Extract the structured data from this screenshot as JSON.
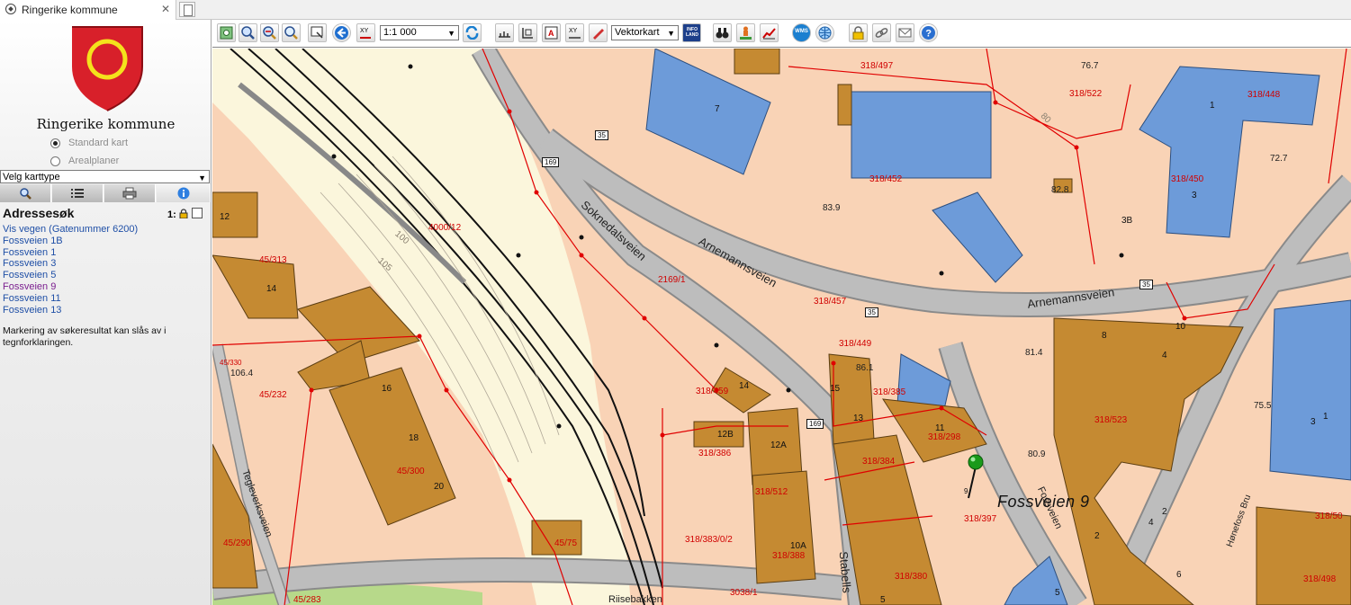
{
  "browser": {
    "tab_title": "Ringerike kommune",
    "close_glyph": "✕",
    "icons": {
      "site": "compass-icon",
      "new_tab": "new-tab-icon"
    }
  },
  "sidebar": {
    "org_name": "Ringerike kommune",
    "map_modes": [
      {
        "label": "Standard kart",
        "selected": true
      },
      {
        "label": "Arealplaner",
        "selected": false
      }
    ],
    "map_type_select": "Velg karttype",
    "tool_tabs": [
      {
        "icon": "search-icon",
        "active": false
      },
      {
        "icon": "layers-list-icon",
        "active": false
      },
      {
        "icon": "print-icon",
        "active": false
      },
      {
        "icon": "info-icon",
        "active": true
      }
    ],
    "panel_title": "Adressesøk",
    "scale_prefix": "1:",
    "lock_icon": "lock-icon",
    "results": [
      {
        "label": "Vis vegen (Gatenummer 6200)",
        "visited": false
      },
      {
        "label": "Fossveien 1B",
        "visited": false
      },
      {
        "label": "Fossveien 1",
        "visited": false
      },
      {
        "label": "Fossveien 3",
        "visited": false
      },
      {
        "label": "Fossveien 5",
        "visited": false
      },
      {
        "label": "Fossveien 9",
        "visited": true
      },
      {
        "label": "Fossveien 11",
        "visited": false
      },
      {
        "label": "Fossveien 13",
        "visited": false
      }
    ],
    "note": "Markering av søkeresultat kan slås av i tegnforklaringen."
  },
  "toolbar": {
    "scale_value": "1:1 000",
    "map_type_value": "Vektorkart",
    "info_land_label": "INFO LAND",
    "wms_label": "WMS",
    "buttons": [
      "zoom-extent-icon",
      "zoom-in-icon",
      "zoom-out-icon",
      "zoom-magnifier-icon",
      "zoom-window-icon",
      "back-arrow-icon",
      "xy-coordinate-icon",
      "refresh-icon",
      "measure-line-icon",
      "measure-area-icon",
      "address-label-icon",
      "xy-plot-icon",
      "draw-pen-icon",
      "infoland-icon",
      "binoculars-icon",
      "street-view-icon",
      "profile-icon",
      "wms-icon",
      "globe-icon",
      "lock-icon",
      "link-icon",
      "email-icon",
      "help-icon"
    ]
  },
  "map": {
    "colors": {
      "background": "#f9d3b6",
      "building_brown": "#c58a32",
      "building_blue": "#6d9bd9",
      "road": "#b4b4b4",
      "rail_area": "#fbf6dc",
      "property_line": "#e00000",
      "marker": "#1a9a1a"
    },
    "labels": {
      "parcels": [
        "318/497",
        "318/522",
        "318/448",
        "318/452",
        "318/450",
        "4000/12",
        "2169/1",
        "318/457",
        "45/313",
        "318/449",
        "318/459",
        "318/385",
        "318/386",
        "318/523",
        "318/298",
        "318/384",
        "318/512",
        "318/397",
        "45/232",
        "45/300",
        "318/383/0/2",
        "318/388",
        "318/380",
        "318/498",
        "318/50",
        "45/75",
        "45/290",
        "45/283",
        "3038/1",
        "45/330"
      ],
      "streets": [
        "Arnemannsveien",
        "Arnemannsveien",
        "Soknedalsveien",
        "Stabells",
        "Fossveien",
        "Hønefoss Bru",
        "Tegleverksveien",
        "Riisebakken"
      ],
      "road_numbers": [
        "35",
        "35",
        "35",
        "169",
        "169"
      ],
      "house_numbers": [
        "7",
        "1",
        "3",
        "3B",
        "12",
        "14",
        "8",
        "4",
        "10",
        "3",
        "16",
        "18",
        "20",
        "14",
        "12B",
        "12A",
        "10A",
        "15",
        "13",
        "11",
        "9",
        "2",
        "4",
        "2",
        "6",
        "5",
        "5",
        "1"
      ],
      "elevations": [
        "76.7",
        "72.7",
        "82.8",
        "83.9",
        "81.4",
        "80.9",
        "75.5",
        "86.1",
        "106.4"
      ],
      "contours": [
        "100",
        "105",
        "80"
      ],
      "pin_house_number": "9",
      "search_result": "Fossveien 9"
    }
  }
}
